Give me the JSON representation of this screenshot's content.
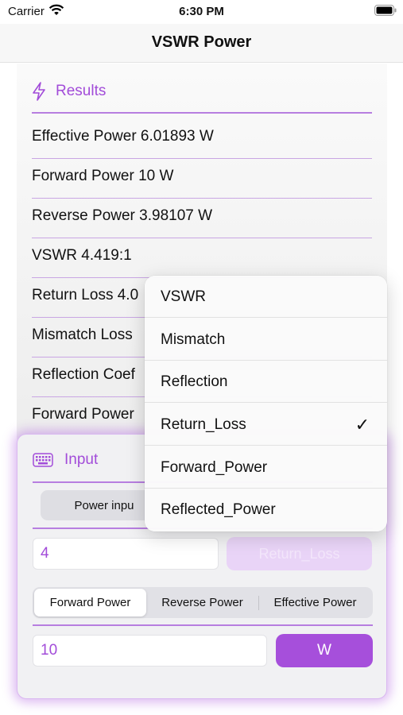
{
  "status_bar": {
    "carrier": "Carrier",
    "time": "6:30 PM"
  },
  "nav": {
    "title": "VSWR Power"
  },
  "results": {
    "title": "Results",
    "icon": "bolt-icon",
    "rows": [
      "Effective Power 6.01893 W",
      "Forward Power 10 W",
      "Reverse Power 3.98107 W",
      "VSWR 4.419:1",
      "Return Loss 4.0",
      "Mismatch Loss",
      "Reflection Coef",
      "Forward Power"
    ]
  },
  "input": {
    "title": "Input",
    "icon": "keyboard-icon",
    "power_input_label": "Power inpu",
    "value_field": "4",
    "mode_button": "Return_Loss",
    "segments": [
      "Forward Power",
      "Reverse Power",
      "Effective Power"
    ],
    "selected_segment": "Forward Power",
    "power_field": "10",
    "unit_button": "W"
  },
  "dropdown": {
    "options": [
      "VSWR",
      "Mismatch",
      "Reflection",
      "Return_Loss",
      "Forward_Power",
      "Reflected_Power"
    ],
    "selected": "Return_Loss",
    "checkmark": "✓"
  },
  "colors": {
    "accent": "#a64fdb",
    "accent_text": "#a24cd9"
  }
}
